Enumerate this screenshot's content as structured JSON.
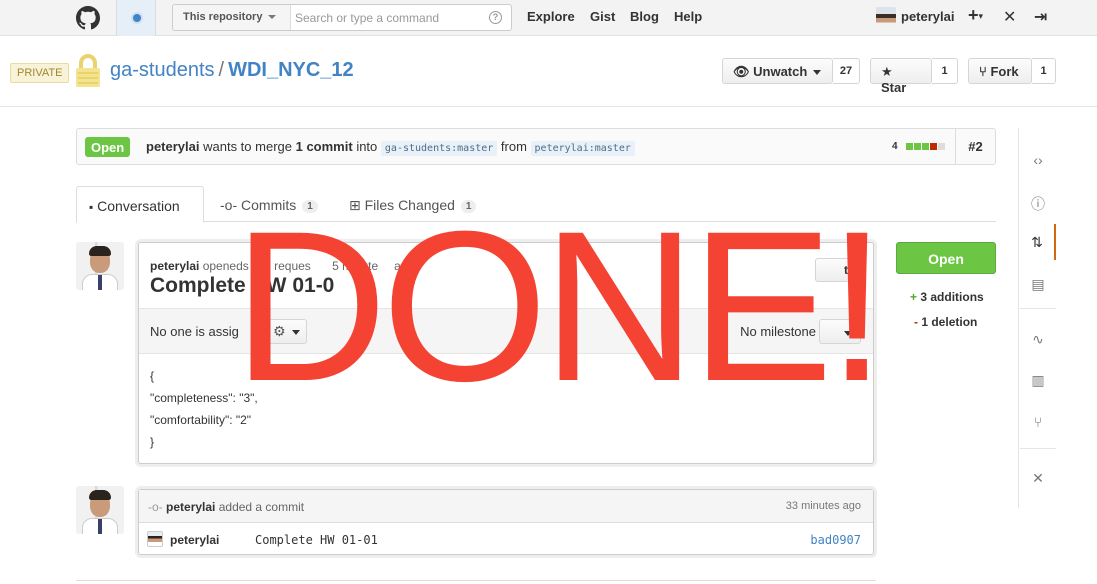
{
  "header": {
    "search_scope": "This repository",
    "search_placeholder": "Search or type a command",
    "nav": [
      "Explore",
      "Gist",
      "Blog",
      "Help"
    ],
    "username": "peterylai"
  },
  "repo": {
    "visibility": "PRIVATE",
    "owner": "ga-students",
    "name": "WDI_NYC_12",
    "unwatch_label": "Unwatch",
    "watch_count": "27",
    "star_label": "Star",
    "star_count": "1",
    "fork_label": "Fork",
    "fork_count": "1"
  },
  "pr": {
    "state": "Open",
    "author": "peterylai",
    "merge_text": "wants to merge",
    "commits_text": "1 commit",
    "into_text": "into",
    "base_branch": "ga-students:master",
    "from_text": "from",
    "head_branch": "peterylai:master",
    "diff_total": "4",
    "number": "#2"
  },
  "tabs": [
    {
      "label": "Conversation",
      "count": ""
    },
    {
      "label": "Commits",
      "count": "1"
    },
    {
      "label": "Files Changed",
      "count": "1"
    }
  ],
  "discussion": {
    "author": "peterylai",
    "meta_visible": "opened",
    "meta_tail": "s pull reques",
    "meta_tail2": "5 minute",
    "meta_tail3": "ago",
    "title": "Complete HW 01-0",
    "edit_label": "t",
    "assignee_text": "No one is assig",
    "milestone_text": "No milestone",
    "body_lines": [
      "{",
      "\"completeness\": \"3\",",
      "\"comfortability\": \"2\"",
      "}"
    ]
  },
  "overlay_text": "DONE!",
  "sidebar": {
    "open_button": "Open",
    "additions": "3 additions",
    "additions_sign": "+",
    "deletions": "1 deletion",
    "deletions_sign": "-"
  },
  "commit_event": {
    "author": "peterylai",
    "action": "added a commit",
    "time": "33 minutes ago",
    "commit_user": "peterylai",
    "commit_message": "Complete HW 01-01",
    "sha": "bad0907"
  },
  "colors": {
    "accent_link": "#4183c4",
    "open_green": "#6cc644",
    "overlay_red": "#f44333",
    "active_nav": "#d26911"
  }
}
